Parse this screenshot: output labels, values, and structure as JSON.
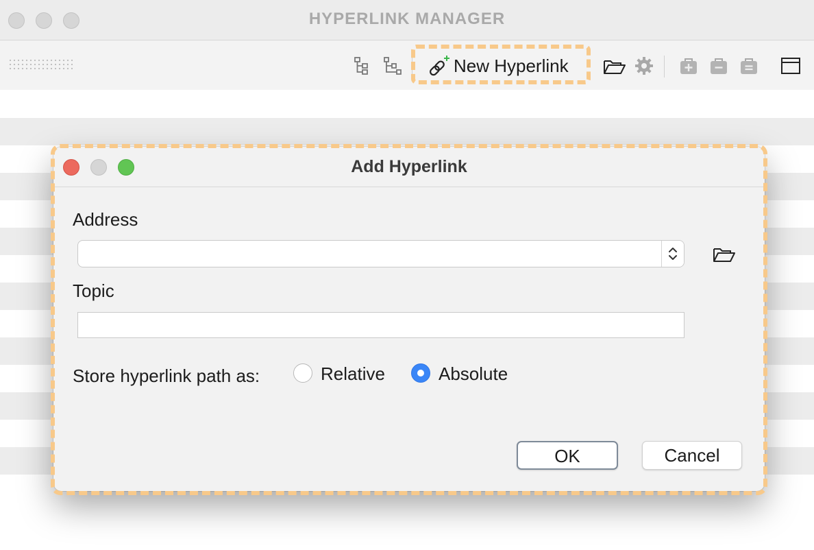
{
  "app": {
    "title": "HYPERLINK MANAGER"
  },
  "toolbar": {
    "new_hyperlink_label": "New Hyperlink",
    "icons": [
      "tree-collapse-icon",
      "tree-expand-icon",
      "link-add-icon",
      "folder-open-icon",
      "gear-icon",
      "add-item-icon",
      "remove-item-icon",
      "edit-item-icon",
      "window-icon"
    ]
  },
  "dialog": {
    "title": "Add Hyperlink",
    "address_label": "Address",
    "address_value": "",
    "topic_label": "Topic",
    "topic_value": "",
    "store_path_label": "Store hyperlink path as:",
    "path_options": [
      {
        "label": "Relative",
        "selected": false
      },
      {
        "label": "Absolute",
        "selected": true
      }
    ],
    "ok_label": "OK",
    "cancel_label": "Cancel"
  },
  "colors": {
    "highlight_dash": "#f8c98a",
    "radio_selected": "#3a86f7",
    "close_red": "#ec6a5e",
    "zoom_green": "#61c554"
  }
}
